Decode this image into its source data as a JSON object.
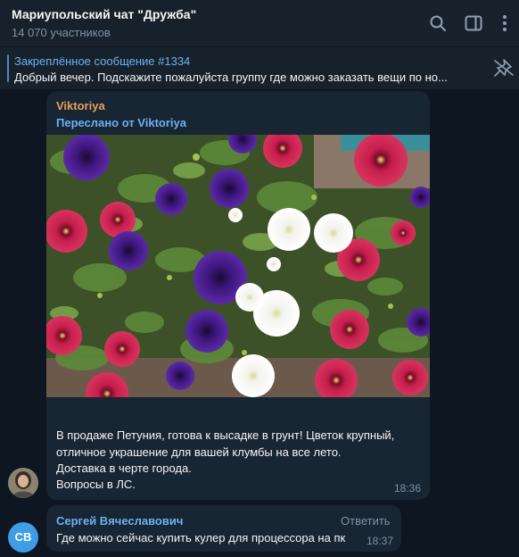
{
  "header": {
    "title": "Мариупольский чат \"Дружба\"",
    "subtitle": "14 070 участников",
    "icons": [
      "search-icon",
      "sidebar-toggle-icon",
      "more-vertical-icon"
    ]
  },
  "pinned": {
    "title": "Закреплённое сообщение #1334",
    "text": "Добрый вечер. Подскажите пожалуйста группу где можно заказать вещи по но...",
    "icon": "unpin-icon"
  },
  "messages": [
    {
      "sender": "Viktoriya",
      "forwarded_from": "Переслано от Viktoriya",
      "has_photo": true,
      "lines": [
        "В продаже Петуния, готова к высадке в грунт! Цветок крупный,",
        "отличное украшение для вашей клумбы на все лето.",
        "Доставка в черте города.",
        "Вопросы в ЛС."
      ],
      "time": "18:36"
    },
    {
      "sender": "Сергей Вячеславович",
      "avatar_initials": "СВ",
      "reply_label": "Ответить",
      "text": "Где можно сейчас купить кулер для процессора на пк",
      "time": "18:37"
    }
  ],
  "colors": {
    "background": "#0e1621",
    "panel": "#17212b",
    "bubble": "#182533",
    "accent_blue": "#6ab3f3",
    "sender_orange": "#e8a05f",
    "muted": "#7f91a4",
    "avatar_blue": "#3d9ee7"
  }
}
